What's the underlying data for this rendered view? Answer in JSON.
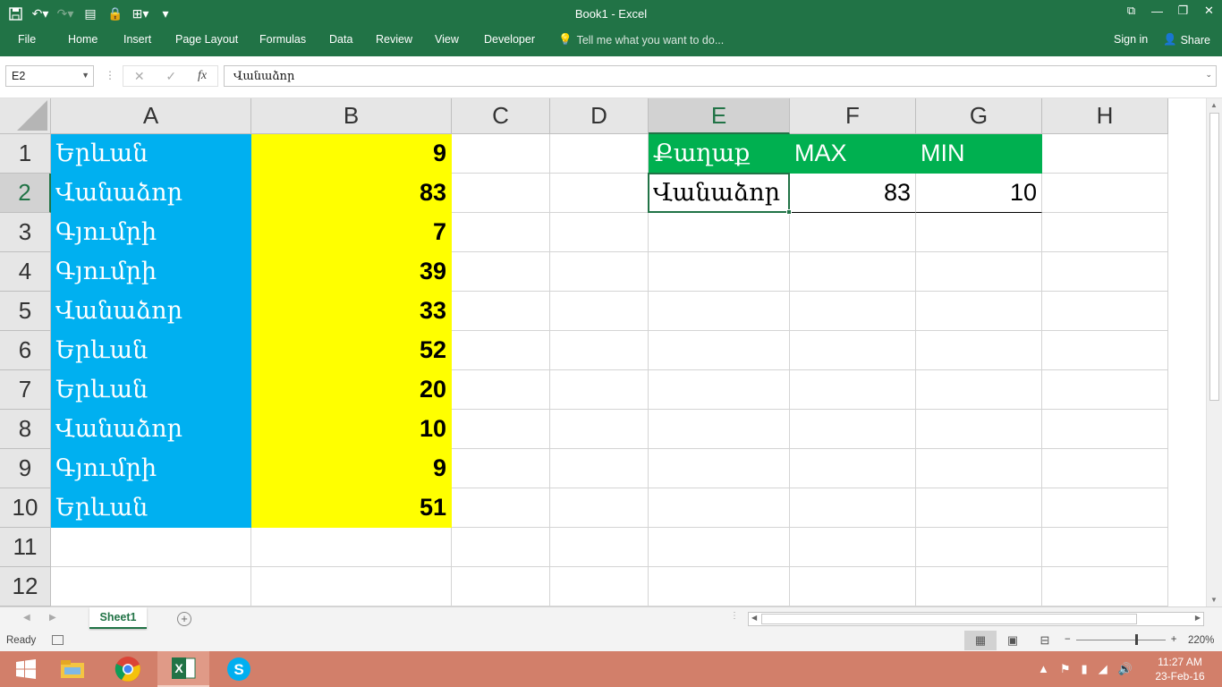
{
  "window": {
    "title": "Book1 - Excel"
  },
  "ribbon": {
    "tabs": [
      "File",
      "Home",
      "Insert",
      "Page Layout",
      "Formulas",
      "Data",
      "Review",
      "View",
      "Developer"
    ],
    "tell_me": "Tell me what you want to do...",
    "sign_in": "Sign in",
    "share": "Share"
  },
  "formula_bar": {
    "name_box": "E2",
    "fx": "fx",
    "content": "Վանաձոր"
  },
  "columns": [
    "A",
    "B",
    "C",
    "D",
    "E",
    "F",
    "G",
    "H"
  ],
  "rows": [
    "1",
    "2",
    "3",
    "4",
    "5",
    "6",
    "7",
    "8",
    "9",
    "10",
    "11",
    "12"
  ],
  "cells": {
    "A": [
      "Երևան",
      "Վանաձոր",
      "Գյումրի",
      "Գյումրի",
      "Վանաձոր",
      "Երևան",
      "Երևան",
      "Վանաձոր",
      "Գյումրի",
      "Երևան"
    ],
    "B": [
      "9",
      "83",
      "7",
      "39",
      "33",
      "52",
      "20",
      "10",
      "9",
      "51"
    ],
    "E1": "Քաղաք",
    "F1": "MAX",
    "G1": "MIN",
    "E2": "Վանաձոր",
    "F2": "83",
    "G2": "10"
  },
  "colors": {
    "col_a_fill": "#00B0F0",
    "col_b_fill": "#FFFF00",
    "header_fill": "#00B050",
    "excel_green": "#217346"
  },
  "sheet_tabs": [
    "Sheet1"
  ],
  "status": {
    "ready": "Ready",
    "zoom": "220%"
  },
  "taskbar": {
    "time": "11:27 AM",
    "date": "23-Feb-16"
  }
}
